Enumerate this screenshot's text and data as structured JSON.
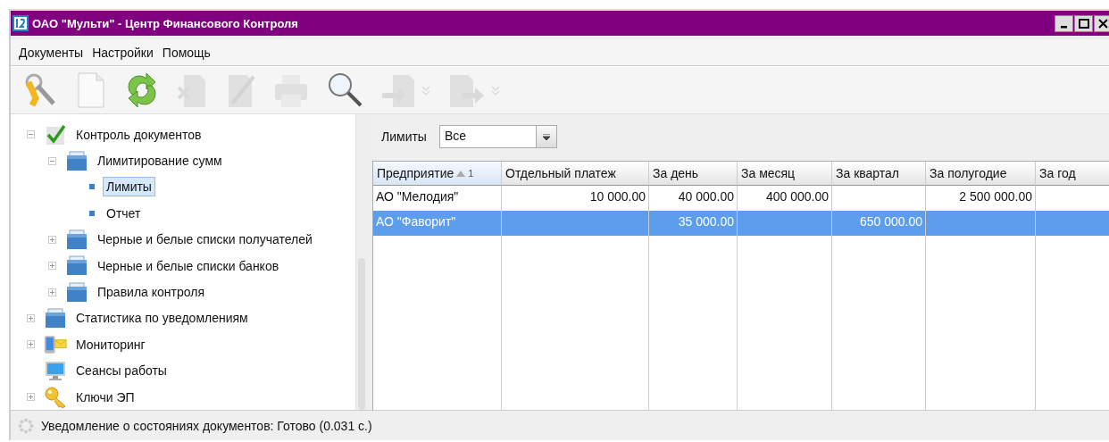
{
  "window": {
    "title": "ОАО \"Мульти\" - Центр Финансового Контроля"
  },
  "menu": [
    "Документы",
    "Настройки",
    "Помощь"
  ],
  "toolbar": [
    {
      "kind": "key",
      "disabled": false
    },
    {
      "kind": "document",
      "disabled": false
    },
    {
      "kind": "refresh",
      "disabled": false
    },
    {
      "kind": "delete",
      "disabled": true
    },
    {
      "kind": "edit",
      "disabled": true
    },
    {
      "kind": "print",
      "disabled": true
    },
    {
      "kind": "search",
      "disabled": false
    },
    {
      "kind": "import",
      "disabled": true
    },
    {
      "kind": "export",
      "disabled": true
    }
  ],
  "tree": [
    {
      "label": "Контроль документов",
      "kind": "check",
      "expanded": true,
      "selected": false,
      "children": [
        {
          "label": "Лимитирование сумм",
          "kind": "folder",
          "expanded": true,
          "selected": false,
          "children": [
            {
              "label": "Лимиты",
              "kind": "bullet",
              "selected": true
            },
            {
              "label": "Отчет",
              "kind": "bullet",
              "selected": false
            }
          ]
        },
        {
          "label": "Черные и белые списки получателей",
          "kind": "folder",
          "expanded": false,
          "selected": false
        },
        {
          "label": "Черные и белые списки банков",
          "kind": "folder",
          "expanded": false,
          "selected": false
        },
        {
          "label": "Правила контроля",
          "kind": "folder",
          "expanded": false,
          "selected": false
        }
      ]
    },
    {
      "label": "Статистика по уведомлениям",
      "kind": "folder",
      "expanded": false,
      "selected": false
    },
    {
      "label": "Мониторинг",
      "kind": "phone-mail",
      "expanded": false,
      "selected": false
    },
    {
      "label": "Сеансы работы",
      "kind": "monitor",
      "selected": false
    },
    {
      "label": "Ключи ЭП",
      "kind": "key",
      "expanded": false,
      "selected": false
    }
  ],
  "filter": {
    "label": "Лимиты",
    "value": "Все"
  },
  "table": {
    "columns": [
      {
        "label": "Предприятие",
        "sort_order": "1"
      },
      {
        "label": "Отдельный платеж"
      },
      {
        "label": "За день"
      },
      {
        "label": "За месяц"
      },
      {
        "label": "За квартал"
      },
      {
        "label": "За полугодие"
      },
      {
        "label": "За год"
      }
    ],
    "rows": [
      {
        "selected": false,
        "cells": [
          "АО \"Мелодия\"",
          "10 000.00",
          "40 000.00",
          "400 000.00",
          "",
          "2 500 000.00",
          ""
        ]
      },
      {
        "selected": true,
        "cells": [
          "АО \"Фаворит\"",
          "",
          "35 000.00",
          "",
          "650 000.00",
          "",
          ""
        ]
      }
    ]
  },
  "status_bar": {
    "text": "Уведомление о состояниях документов: Готово (0.031 с.)"
  }
}
